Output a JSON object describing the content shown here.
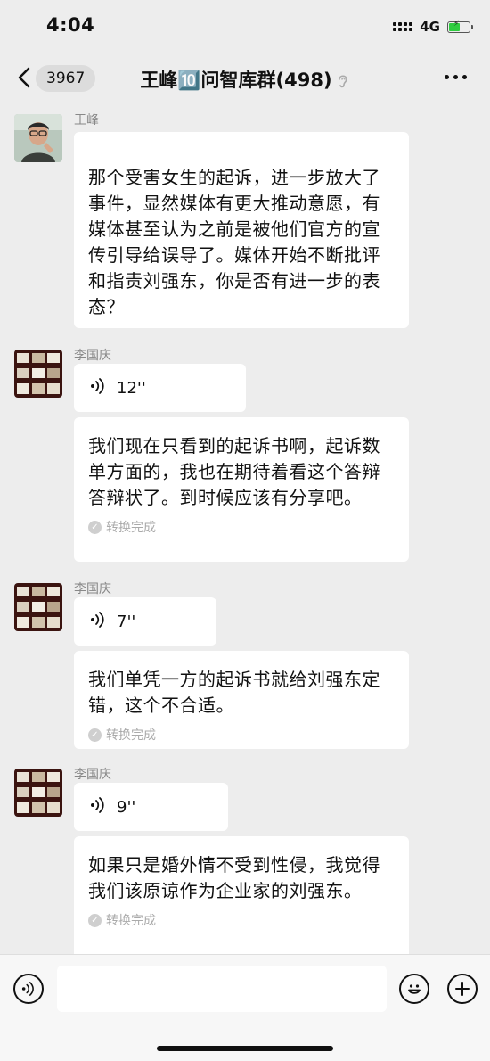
{
  "status": {
    "time": "4:04",
    "network": "4G"
  },
  "nav": {
    "back_count": "3967",
    "title": "王峰🔟问智库群(498)"
  },
  "messages": [
    {
      "sender": "王峰",
      "type": "text",
      "text": "那个受害女生的起诉，进一步放大了事件，显然媒体有更大推动意愿，有媒体甚至认为之前是被他们官方的宣传引导给误导了。媒体开始不断批评和指责刘强东，你是否有进一步的表态？"
    },
    {
      "sender": "李国庆",
      "type": "voice",
      "duration": "12''",
      "transcript": "我们现在只看到的起诉书啊，起诉数单方面的，我也在期待着看这个答辩答辩状了。到时候应该有分享吧。",
      "status": "转换完成"
    },
    {
      "sender": "李国庆",
      "type": "voice",
      "duration": "7''",
      "transcript": "我们单凭一方的起诉书就给刘强东定错，这个不合适。",
      "status": "转换完成"
    },
    {
      "sender": "李国庆",
      "type": "voice",
      "duration": "9''",
      "transcript": "如果只是婚外情不受到性侵，我觉得我们该原谅作为企业家的刘强东。",
      "status": "转换完成"
    }
  ],
  "colors": {
    "background": "#ededed",
    "bubble": "#ffffff",
    "meta_text": "#aaaaaa"
  }
}
